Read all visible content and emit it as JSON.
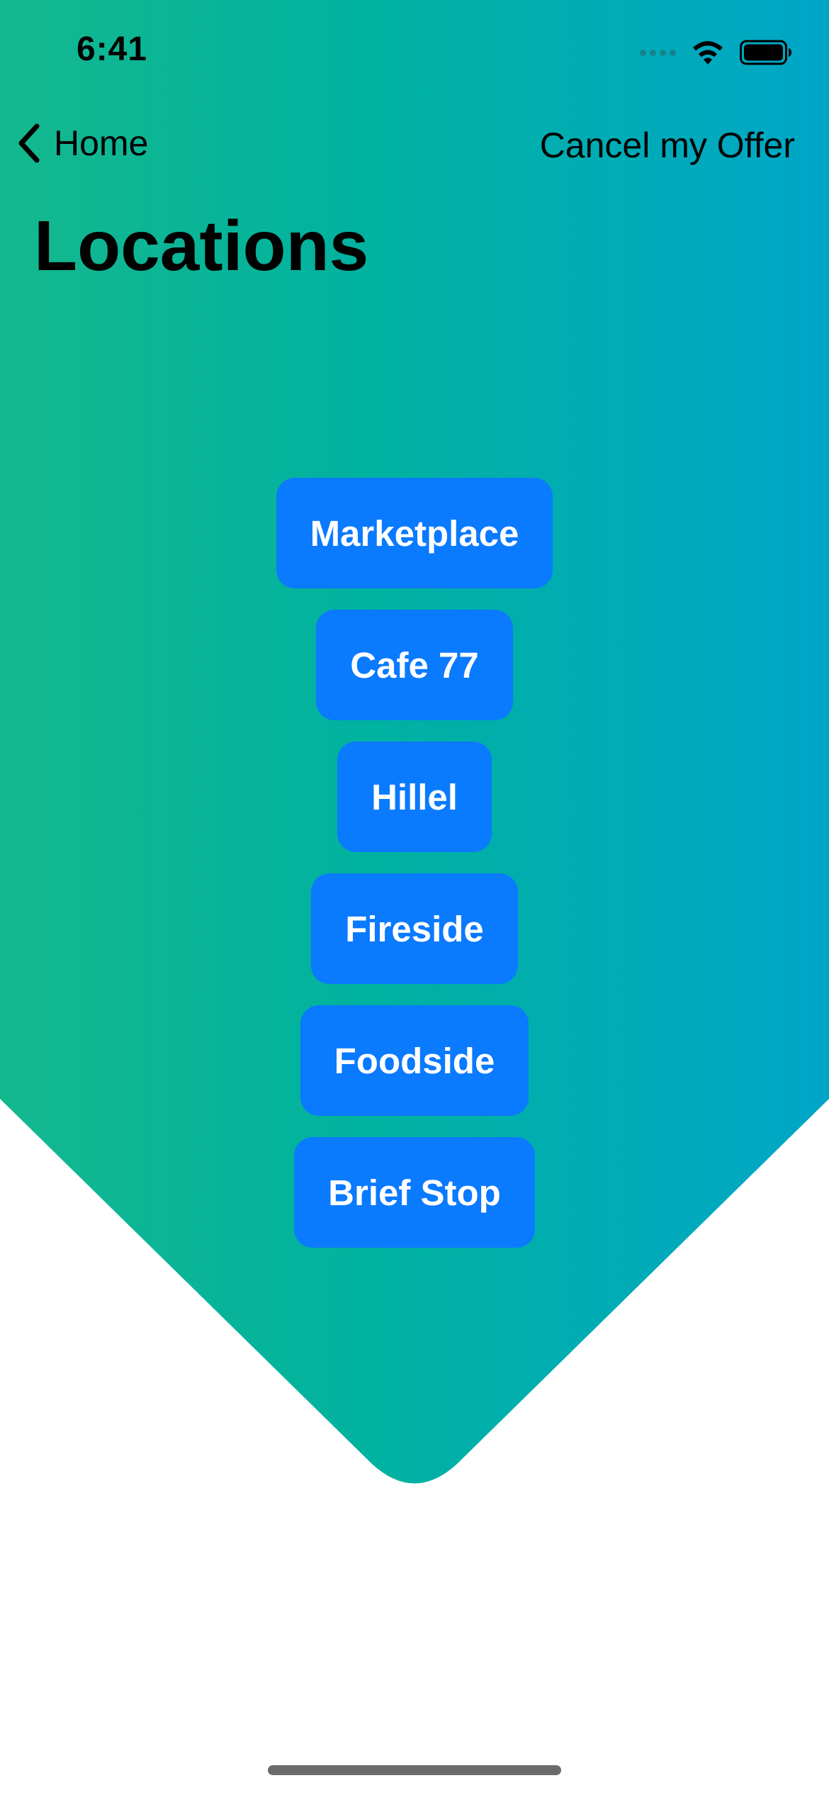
{
  "status_bar": {
    "time": "6:41"
  },
  "nav": {
    "back_label": "Home",
    "right_action_label": "Cancel my Offer"
  },
  "page": {
    "title": "Locations"
  },
  "locations": [
    {
      "label": "Marketplace"
    },
    {
      "label": "Cafe 77"
    },
    {
      "label": "Hillel"
    },
    {
      "label": "Fireside"
    },
    {
      "label": "Foodside"
    },
    {
      "label": "Brief Stop"
    }
  ],
  "icons": {
    "back": "chevron-left-icon",
    "cellular": "cellular-signal-icon",
    "wifi": "wifi-icon",
    "battery": "battery-icon"
  },
  "colors": {
    "gradient_start": "#14B88E",
    "gradient_end": "#00A6C8",
    "button": "#0A7AFF",
    "button_text": "#FFFFFF"
  }
}
